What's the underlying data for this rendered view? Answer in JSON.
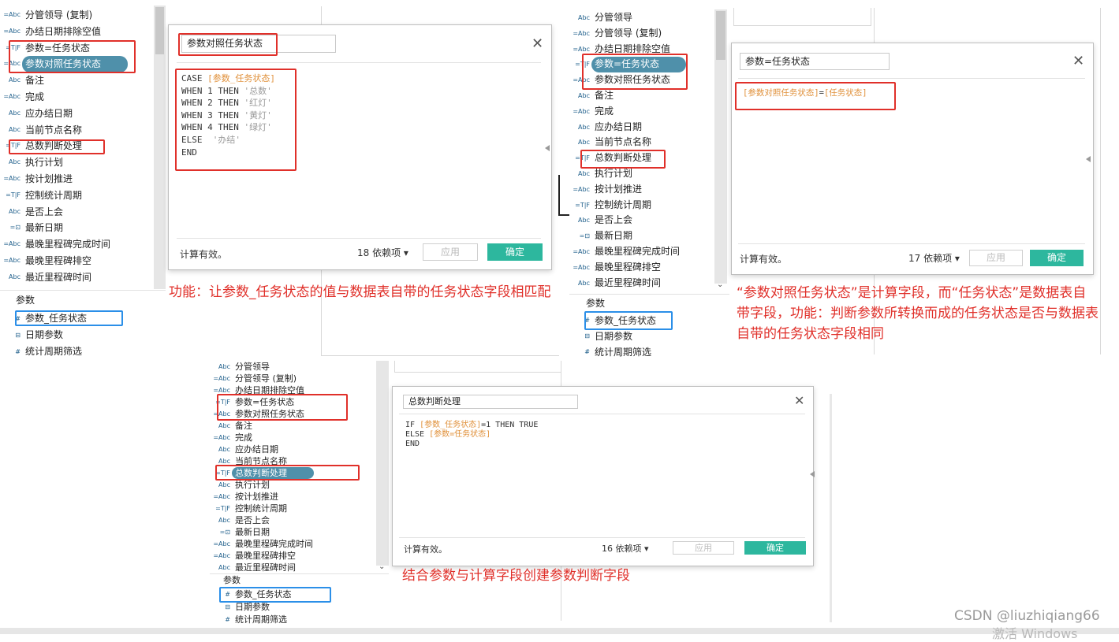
{
  "field_lists": {
    "p1": {
      "fields": [
        {
          "icon": "=Abc",
          "label": "分管领导 (复制)"
        },
        {
          "icon": "=Abc",
          "label": "办结日期排除空值"
        },
        {
          "icon": "=T|F",
          "label": "参数=任务状态"
        },
        {
          "icon": "=Abc",
          "label": "参数对照任务状态",
          "selected": true
        },
        {
          "icon": "Abc",
          "label": "备注"
        },
        {
          "icon": "=Abc",
          "label": "完成"
        },
        {
          "icon": "Abc",
          "label": "应办结日期"
        },
        {
          "icon": "Abc",
          "label": "当前节点名称"
        },
        {
          "icon": "=T|F",
          "label": "总数判断处理"
        },
        {
          "icon": "Abc",
          "label": "执行计划"
        },
        {
          "icon": "=Abc",
          "label": "按计划推进"
        },
        {
          "icon": "=T|F",
          "label": "控制统计周期"
        },
        {
          "icon": "Abc",
          "label": "是否上会"
        },
        {
          "icon": "=⊡",
          "label": "最新日期"
        },
        {
          "icon": "=Abc",
          "label": "最晚里程碑完成时间"
        },
        {
          "icon": "=Abc",
          "label": "最晚里程碑排空"
        },
        {
          "icon": "Abc",
          "label": "最近里程碑时间"
        }
      ],
      "params_title": "参数",
      "params": [
        {
          "icon": "#",
          "label": "参数_任务状态"
        },
        {
          "icon": "⊟",
          "label": "日期参数"
        },
        {
          "icon": "#",
          "label": "统计周期筛选"
        }
      ]
    },
    "p2": {
      "fields": [
        {
          "icon": "Abc",
          "label": "分管领导"
        },
        {
          "icon": "=Abc",
          "label": "分管领导 (复制)"
        },
        {
          "icon": "=Abc",
          "label": "办结日期排除空值"
        },
        {
          "icon": "=T|F",
          "label": "参数=任务状态",
          "selected": true
        },
        {
          "icon": "=Abc",
          "label": "参数对照任务状态"
        },
        {
          "icon": "Abc",
          "label": "备注"
        },
        {
          "icon": "=Abc",
          "label": "完成"
        },
        {
          "icon": "Abc",
          "label": "应办结日期"
        },
        {
          "icon": "Abc",
          "label": "当前节点名称"
        },
        {
          "icon": "=T|F",
          "label": "总数判断处理"
        },
        {
          "icon": "Abc",
          "label": "执行计划"
        },
        {
          "icon": "=Abc",
          "label": "按计划推进"
        },
        {
          "icon": "=T|F",
          "label": "控制统计周期"
        },
        {
          "icon": "Abc",
          "label": "是否上会"
        },
        {
          "icon": "=⊡",
          "label": "最新日期"
        },
        {
          "icon": "=Abc",
          "label": "最晚里程碑完成时间"
        },
        {
          "icon": "=Abc",
          "label": "最晚里程碑排空"
        },
        {
          "icon": "Abc",
          "label": "最近里程碑时间"
        }
      ],
      "params_title": "参数",
      "params": [
        {
          "icon": "#",
          "label": "参数_任务状态"
        },
        {
          "icon": "⊟",
          "label": "日期参数"
        },
        {
          "icon": "#",
          "label": "统计周期筛选"
        }
      ]
    },
    "p3": {
      "fields": [
        {
          "icon": "Abc",
          "label": "分管领导"
        },
        {
          "icon": "=Abc",
          "label": "分管领导 (复制)"
        },
        {
          "icon": "=Abc",
          "label": "办结日期排除空值"
        },
        {
          "icon": "=T|F",
          "label": "参数=任务状态"
        },
        {
          "icon": "=Abc",
          "label": "参数对照任务状态"
        },
        {
          "icon": "Abc",
          "label": "备注"
        },
        {
          "icon": "=Abc",
          "label": "完成"
        },
        {
          "icon": "Abc",
          "label": "应办结日期"
        },
        {
          "icon": "Abc",
          "label": "当前节点名称"
        },
        {
          "icon": "=T|F",
          "label": "总数判断处理",
          "selected": true
        },
        {
          "icon": "Abc",
          "label": "执行计划"
        },
        {
          "icon": "=Abc",
          "label": "按计划推进"
        },
        {
          "icon": "=T|F",
          "label": "控制统计周期"
        },
        {
          "icon": "Abc",
          "label": "是否上会"
        },
        {
          "icon": "=⊡",
          "label": "最新日期"
        },
        {
          "icon": "=Abc",
          "label": "最晚里程碑完成时间"
        },
        {
          "icon": "=Abc",
          "label": "最晚里程碑排空"
        },
        {
          "icon": "Abc",
          "label": "最近里程碑时间"
        }
      ],
      "params_title": "参数",
      "params": [
        {
          "icon": "#",
          "label": "参数_任务状态"
        },
        {
          "icon": "⊟",
          "label": "日期参数"
        },
        {
          "icon": "#",
          "label": "统计周期筛选"
        }
      ]
    }
  },
  "dialogs": {
    "d1": {
      "name": "参数对照任务状态",
      "status": "计算有效。",
      "deps": "18 依赖项 ▾",
      "apply": "应用",
      "ok": "确定",
      "code": [
        [
          {
            "t": "CASE "
          },
          {
            "t": "[参数_任务状态]",
            "c": "fld"
          }
        ],
        [
          {
            "t": "WHEN 1 THEN "
          },
          {
            "t": "'总数'",
            "c": "str"
          }
        ],
        [
          {
            "t": "WHEN 2 THEN "
          },
          {
            "t": "'红灯'",
            "c": "str"
          }
        ],
        [
          {
            "t": "WHEN 3 THEN "
          },
          {
            "t": "'黄灯'",
            "c": "str"
          }
        ],
        [
          {
            "t": "WHEN 4 THEN "
          },
          {
            "t": "'绿灯'",
            "c": "str"
          }
        ],
        [
          {
            "t": "ELSE  "
          },
          {
            "t": "'办结'",
            "c": "str"
          }
        ],
        [
          {
            "t": "END"
          }
        ]
      ]
    },
    "d2": {
      "name": "参数=任务状态",
      "status": "计算有效。",
      "deps": "17 依赖项 ▾",
      "apply": "应用",
      "ok": "确定",
      "code": [
        [
          {
            "t": "[参数对照任务状态]",
            "c": "fld"
          },
          {
            "t": "="
          },
          {
            "t": "[任务状态]",
            "c": "fld"
          }
        ]
      ]
    },
    "d3": {
      "name": "总数判断处理",
      "status": "计算有效。",
      "deps": "16 依赖项 ▾",
      "apply": "应用",
      "ok": "确定",
      "code": [
        [
          {
            "t": "IF "
          },
          {
            "t": "[参数_任务状态]",
            "c": "fld"
          },
          {
            "t": "=1 THEN TRUE"
          }
        ],
        [
          {
            "t": "ELSE "
          },
          {
            "t": "[参数=任务状态]",
            "c": "fld"
          }
        ],
        [
          {
            "t": "END"
          }
        ]
      ]
    }
  },
  "annotations": {
    "note1": "功能：让参数_任务状态的值与数据表自带的任务状态字段相匹配",
    "note2": "“参数对照任务状态”是计算字段，而“任务状态”是数据表自带字段，功能：判断参数所转换而成的任务状态是否与数据表自带的任务状态字段相同",
    "note3": "结合参数与计算字段创建参数判断字段"
  },
  "watermark": "CSDN @liuzhiqiang66",
  "os_watermark": "激活 Windows",
  "colors": {
    "accent_red": "#e0302a",
    "accent_blue": "#2b8fe8",
    "selected": "#4f90aa",
    "ok_button": "#2db79e",
    "field_color": "#e0903a"
  }
}
